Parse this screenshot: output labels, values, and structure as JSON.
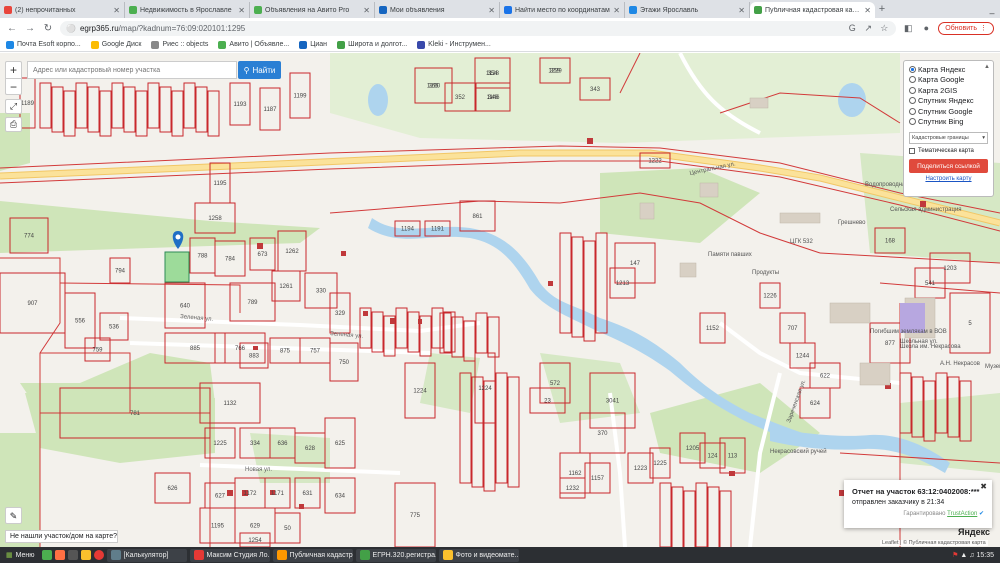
{
  "browser": {
    "tabs": [
      {
        "label": "(2) непрочитанных",
        "color": "#e8453c",
        "active": false
      },
      {
        "label": "Недвижимость в Ярославле",
        "color": "#4caf50",
        "active": false
      },
      {
        "label": "Объявления на Авито Pro",
        "color": "#4caf50",
        "active": false
      },
      {
        "label": "Мои объявления",
        "color": "#1565c0",
        "active": false
      },
      {
        "label": "Найти место по координатам",
        "color": "#1a73e8",
        "active": false
      },
      {
        "label": "Этажи Ярославль",
        "color": "#1e88e5",
        "active": false
      },
      {
        "label": "Публичная кадастровая карта",
        "color": "#43a047",
        "active": true
      }
    ],
    "url_host": "egrp365.ru",
    "url_path": "/map/?kadnum=76:09:020101:1295",
    "update_label": "Обновить",
    "bookmarks": [
      {
        "label": "Почта Esoft корпо...",
        "color": "#1e88e5"
      },
      {
        "label": "Google Диск",
        "color": "#fbbc04"
      },
      {
        "label": "Риес :: objects",
        "color": "#888888"
      },
      {
        "label": "Авито | Объявле...",
        "color": "#4caf50"
      },
      {
        "label": "Циан",
        "color": "#1565c0"
      },
      {
        "label": "Широта и долгот...",
        "color": "#43a047"
      },
      {
        "label": "Kleki - Инструмен...",
        "color": "#3949ab"
      }
    ]
  },
  "map": {
    "search_placeholder": "Адрес или кадастровый номер участка",
    "search_button": "Найти",
    "layers": {
      "options": [
        {
          "label": "Карта Яндекс",
          "selected": true
        },
        {
          "label": "Карта Google",
          "selected": false
        },
        {
          "label": "Карта 2GIS",
          "selected": false
        },
        {
          "label": "Спутник Яндекс",
          "selected": false
        },
        {
          "label": "Спутник Google",
          "selected": false
        },
        {
          "label": "Спутник Bing",
          "selected": false
        }
      ],
      "boundaries_select": "Кадастровые границы",
      "thematic_label": "Тематическая карта",
      "share_button": "Поделиться ссылкой",
      "setup_link": "Настроить карту"
    },
    "report": {
      "title": "Отчет на участок 63:12:0402008:***",
      "status": "отправлен заказчику в 21:34",
      "provider_prefix": "Гарантировано",
      "provider": "TrustAction"
    },
    "not_found": "Не нашли участок/дом на карте?",
    "brand": "Яндекс",
    "attribution": "Leaflet | © Публичная кадастровая карта",
    "place_labels": [
      "Центральная ул.",
      "Грешнево",
      "Памяти павших",
      "Продукты",
      "Водопроводная",
      "Зеленая ул.",
      "Зеленая ул.",
      "Новая ул.",
      "Школьная ул.",
      "А.Н. Некрасов",
      "Погибшим землякам в ВОВ",
      "Школа им. Некрасова",
      "Музей",
      "Сельская администрация",
      "ЦГК 532",
      "Зареченская ул.",
      "Некрасовский ручей"
    ],
    "parcels": [
      "365",
      "354",
      "359",
      "348",
      "352",
      "343",
      "1258",
      "1195",
      "1189",
      "1193",
      "1187",
      "1199",
      "1194",
      "1191",
      "861",
      "788",
      "784",
      "673",
      "1262",
      "640",
      "789",
      "794",
      "1261",
      "330",
      "329",
      "774",
      "907",
      "556",
      "536",
      "885",
      "766",
      "883",
      "875",
      "757",
      "750",
      "759",
      "781",
      "1132",
      "1224",
      "1224",
      "572",
      "3041",
      "23",
      "370",
      "1225",
      "334",
      "636",
      "628",
      "625",
      "626",
      "50",
      "1172",
      "1171",
      "631",
      "634",
      "627",
      "629",
      "1195",
      "1254",
      "775",
      "1162",
      "1157",
      "1232",
      "1223",
      "1225",
      "1205",
      "124",
      "113",
      "147",
      "1213",
      "707",
      "624",
      "622",
      "1244",
      "877",
      "1222",
      "1203",
      "168",
      "541",
      "1226",
      "1152",
      "5",
      "1290",
      "1128",
      "1229",
      "1146"
    ]
  },
  "taskbar": {
    "menu": "Меню",
    "windows": [
      {
        "label": "[Калькулятор]",
        "color": "#607d8b"
      },
      {
        "label": "Максим Студия Ло...",
        "color": "#e53935"
      },
      {
        "label": "Публичная кадастр...",
        "color": "#ff9800"
      },
      {
        "label": "ЕГРН.320.регистра...",
        "color": "#43a047"
      },
      {
        "label": "Фото и видеомате...",
        "color": "#fbc02d"
      }
    ],
    "clock": "15:35"
  }
}
